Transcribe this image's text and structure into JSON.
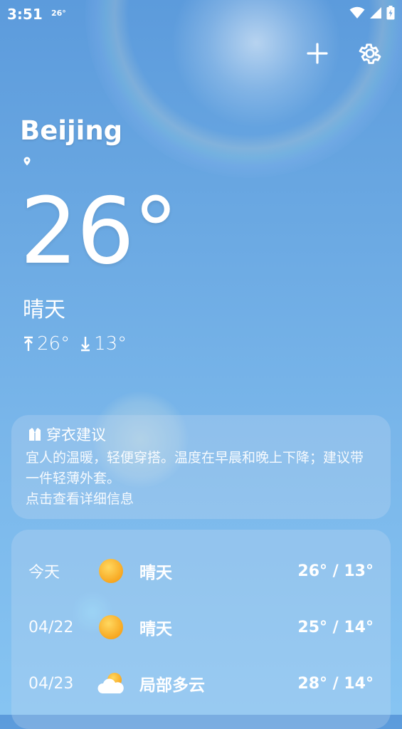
{
  "status_bar": {
    "time": "3:51",
    "temp": "26°"
  },
  "header": {
    "add_icon": "plus-icon",
    "settings_icon": "gear-icon"
  },
  "current": {
    "city": "Beijing",
    "temperature": "26°",
    "condition": "晴天",
    "high": "26°",
    "low": "13°"
  },
  "advice": {
    "title": "穿衣建议",
    "text": "宜人的温暖，轻便穿搭。温度在早晨和晚上下降；建议带一件轻薄外套。",
    "link": "点击查看详细信息"
  },
  "forecast": [
    {
      "date": "今天",
      "icon": "sun-icon",
      "condition": "晴天",
      "temps": "26° / 13°"
    },
    {
      "date": "04/22",
      "icon": "sun-icon",
      "condition": "晴天",
      "temps": "25° / 14°"
    },
    {
      "date": "04/23",
      "icon": "partly-cloudy-icon",
      "condition": "局部多云",
      "temps": "28° / 14°"
    }
  ]
}
